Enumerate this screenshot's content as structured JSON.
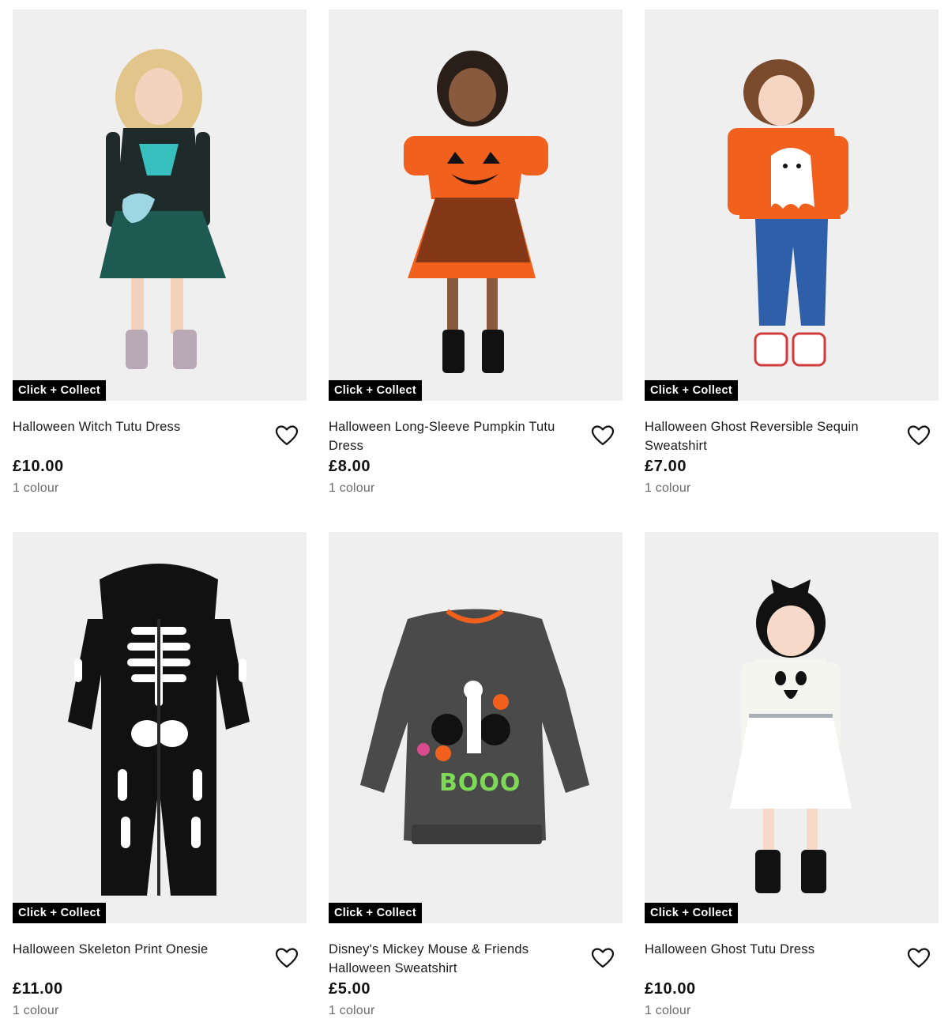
{
  "products": [
    {
      "badge": "Click + Collect",
      "title": "Halloween Witch Tutu Dress",
      "price": "£10.00",
      "colours": "1 colour",
      "image_icon": "child-witch-dress-photo"
    },
    {
      "badge": "Click + Collect",
      "title": "Halloween Long-Sleeve Pumpkin Tutu Dress",
      "price": "£8.00",
      "colours": "1 colour",
      "image_icon": "child-pumpkin-dress-photo"
    },
    {
      "badge": "Click + Collect",
      "title": "Halloween Ghost Reversible Sequin Sweatshirt",
      "price": "£7.00",
      "colours": "1 colour",
      "image_icon": "child-ghost-sweatshirt-photo"
    },
    {
      "badge": "Click + Collect",
      "title": "Halloween Skeleton Print Onesie",
      "price": "£11.00",
      "colours": "1 colour",
      "image_icon": "skeleton-onesie-photo"
    },
    {
      "badge": "Click + Collect",
      "title": "Disney's Mickey Mouse & Friends Halloween Sweatshirt",
      "price": "£5.00",
      "colours": "1 colour",
      "image_icon": "mickey-sweatshirt-photo"
    },
    {
      "badge": "Click + Collect",
      "title": "Halloween Ghost Tutu Dress",
      "price": "£10.00",
      "colours": "1 colour",
      "image_icon": "child-ghost-tutu-photo"
    }
  ],
  "sweatshirt_print_text": "BOOO",
  "colors": {
    "badge_bg": "#000000",
    "image_bg": "#efefef",
    "pumpkin_orange": "#f2601d",
    "muted_text": "#6b6b6b"
  }
}
